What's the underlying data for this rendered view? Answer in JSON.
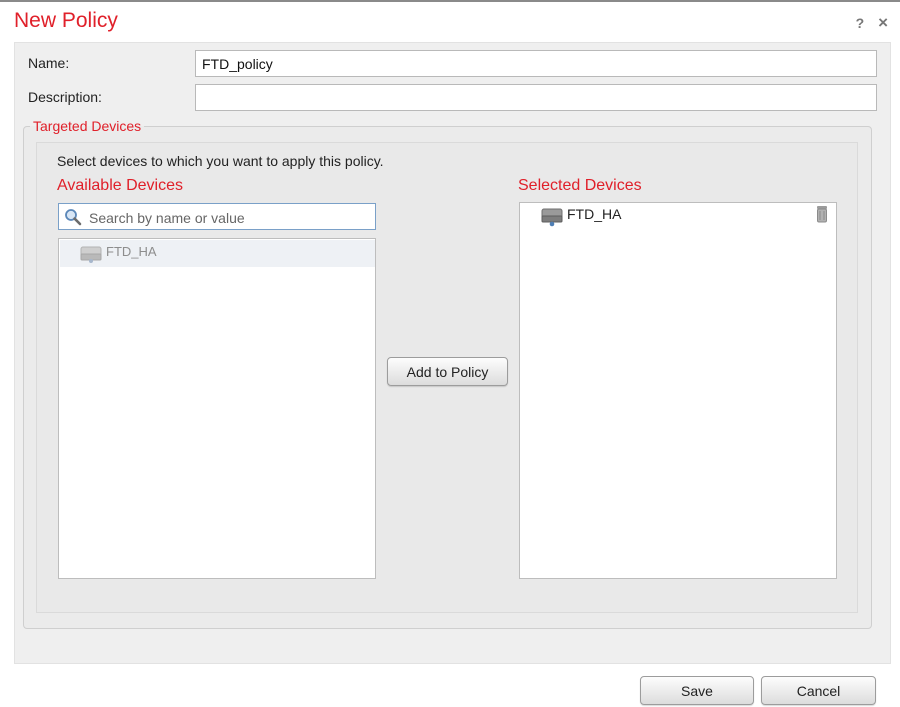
{
  "dialog": {
    "title": "New Policy",
    "help_glyph": "?",
    "close_glyph": "×"
  },
  "form": {
    "name_label": "Name:",
    "name_value": "FTD_policy",
    "description_label": "Description:",
    "description_value": ""
  },
  "targeted": {
    "legend": "Targeted Devices",
    "instruction": "Select devices to which you want to apply this policy.",
    "available_title": "Available Devices",
    "search_placeholder": "Search by name or value",
    "available_items": [
      {
        "label": "FTD_HA",
        "icon": "device-icon"
      }
    ],
    "add_button": "Add to Policy",
    "selected_title": "Selected Devices",
    "selected_items": [
      {
        "label": "FTD_HA",
        "icon": "device-icon"
      }
    ]
  },
  "footer": {
    "save": "Save",
    "cancel": "Cancel"
  },
  "colors": {
    "accent_red": "#e0202a",
    "panel_gray": "#efefef"
  }
}
